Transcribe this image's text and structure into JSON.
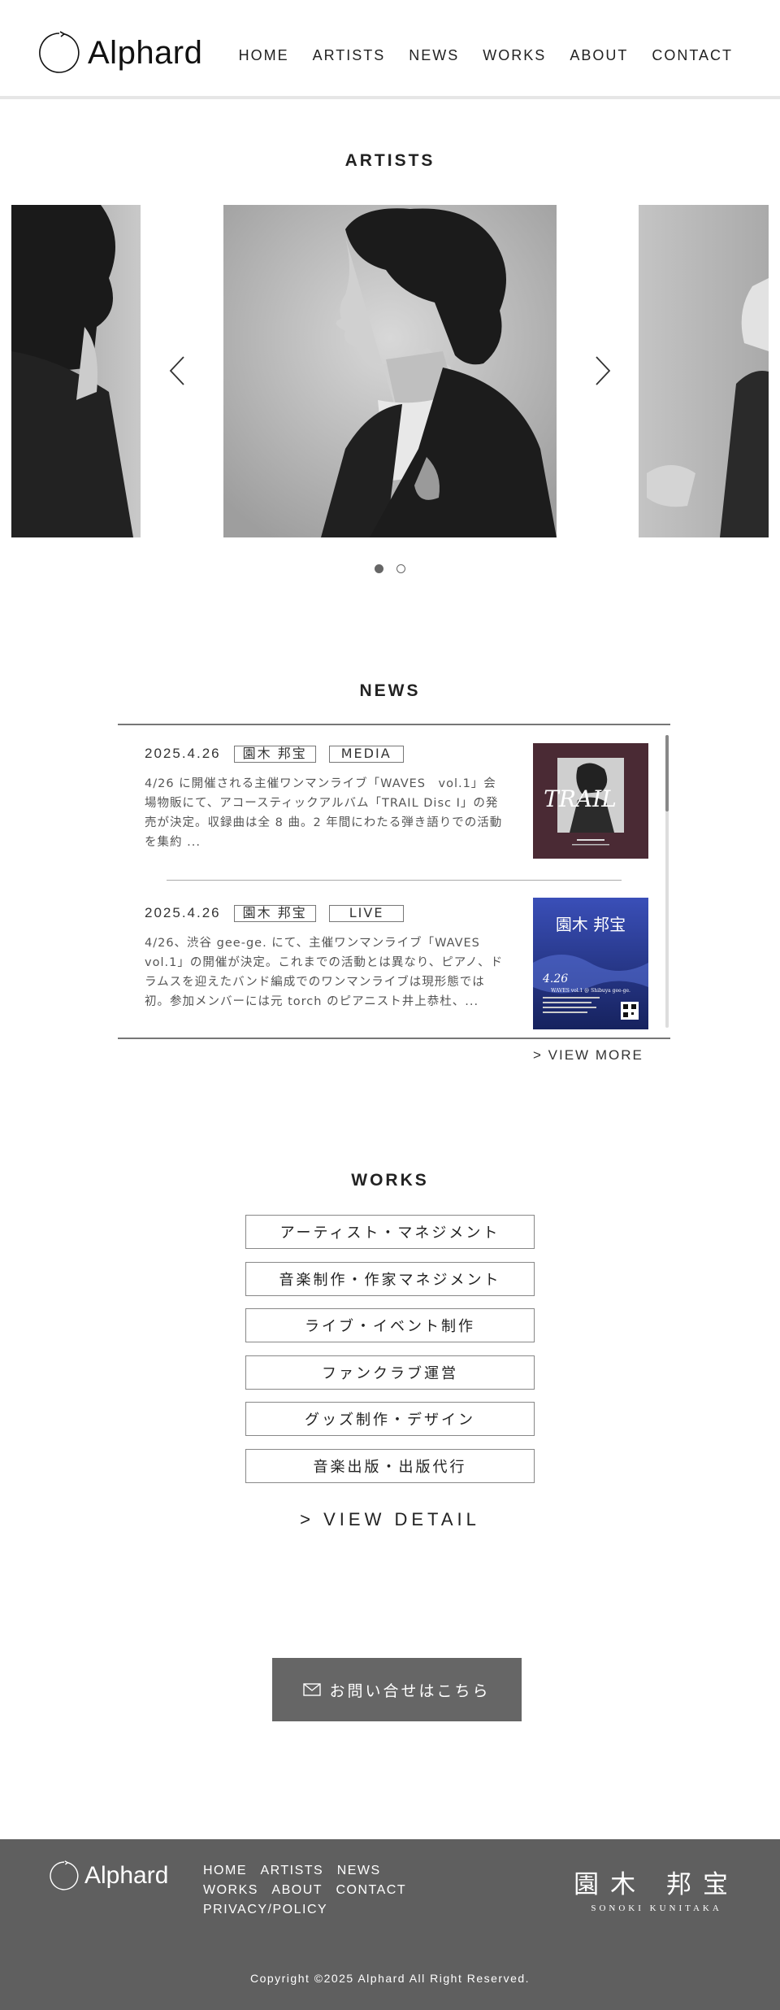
{
  "header": {
    "logo_text": "Alphard",
    "nav": [
      "HOME",
      "ARTISTS",
      "NEWS",
      "WORKS",
      "ABOUT",
      "CONTACT"
    ]
  },
  "artists": {
    "title": "ARTISTS",
    "slides_total": 2,
    "active_slide": 1
  },
  "news": {
    "title": "NEWS",
    "items": [
      {
        "date": "2025.4.26",
        "artist_tag": "園木 邦宝",
        "category_tag": "MEDIA",
        "text": "4/26 に開催される主催ワンマンライブ「WAVES　vol.1」会場物販にて、アコースティックアルバム「TRAIL Disc I」の発売が決定。収録曲は全 8 曲。2 年間にわたる弾き語りでの活動を集約 ...",
        "thumb_text": "TRAIL"
      },
      {
        "date": "2025.4.26",
        "artist_tag": "園木 邦宝",
        "category_tag": "LIVE",
        "text": "4/26、渋谷 gee-ge. にて、主催ワンマンライブ「WAVES vol.1」の開催が決定。これまでの活動とは異なり、ピアノ、ドラムスを迎えたバンド編成でのワンマンライブは現形態では初。参加メンバーには元 torch のピアニスト井上恭杜、...",
        "thumb_name": "園木 邦宝",
        "thumb_date": "4.26",
        "thumb_event": "WAVES vol.1 @ Shibuya gee-ge."
      }
    ],
    "view_more": "> VIEW MORE"
  },
  "works": {
    "title": "WORKS",
    "items": [
      "アーティスト・マネジメント",
      "音楽制作・作家マネジメント",
      "ライブ・イベント制作",
      "ファンクラブ運営",
      "グッズ制作・デザイン",
      "音楽出版・出版代行"
    ],
    "view_detail": "> VIEW DETAIL"
  },
  "contact": {
    "label": "お問い合せはこちら"
  },
  "footer": {
    "logo_text": "Alphard",
    "nav": [
      "HOME",
      "ARTISTS",
      "NEWS",
      "WORKS",
      "ABOUT",
      "CONTACT",
      "PRIVACY/POLICY"
    ],
    "brand_kanji": "園木 邦宝",
    "brand_romaji": "SONOKI KUNITAKA",
    "copyright": "Copyright ©2025 Alphard All Right Reserved."
  },
  "colors": {
    "footer_bg": "#5f5f5f",
    "contact_bg": "#666666",
    "thumb1_bg": "#4a2a34",
    "thumb2_bg": "#1d2c7a"
  }
}
